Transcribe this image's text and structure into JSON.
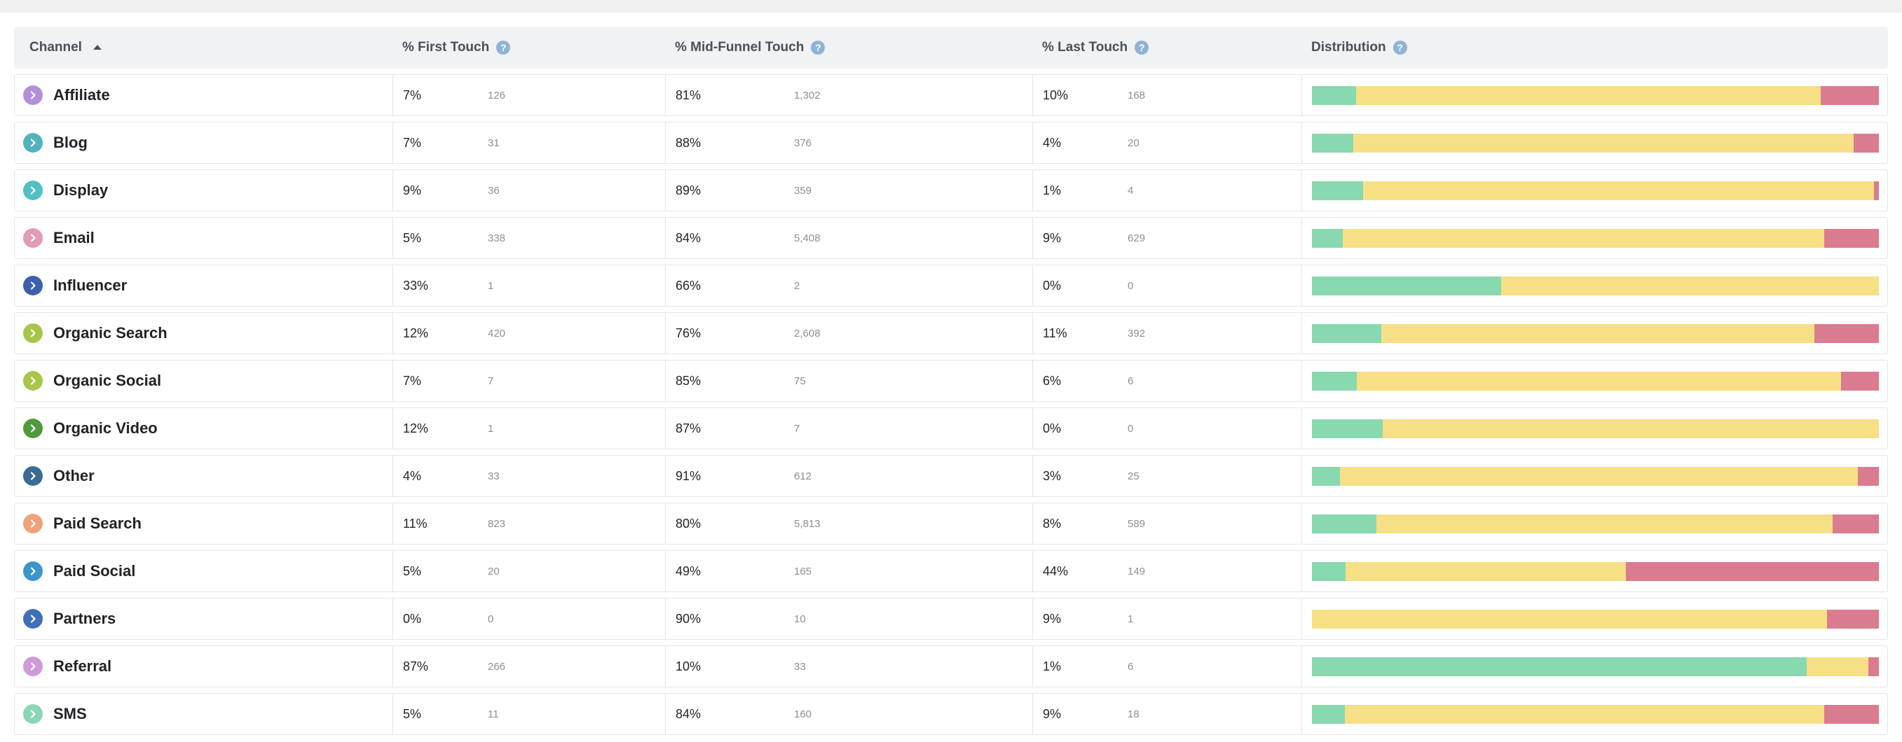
{
  "header": {
    "channel": "Channel",
    "first_touch": "% First Touch",
    "mid_funnel": "% Mid-Funnel Touch",
    "last_touch": "% Last Touch",
    "distribution": "Distribution",
    "help_glyph": "?"
  },
  "colors": {
    "first": "#88d8b0",
    "mid": "#f7df86",
    "last": "#db7b8f"
  },
  "rows": [
    {
      "channel": "Affiliate",
      "icon_color": "#b48fd9",
      "first_pct": "7%",
      "first_count": "126",
      "mid_pct": "81%",
      "mid_count": "1,302",
      "last_pct": "10%",
      "last_count": "168",
      "dist": [
        7.8,
        82.0,
        10.2
      ]
    },
    {
      "channel": "Blog",
      "icon_color": "#4fb3bf",
      "first_pct": "7%",
      "first_count": "31",
      "mid_pct": "88%",
      "mid_count": "376",
      "last_pct": "4%",
      "last_count": "20",
      "dist": [
        7.3,
        88.3,
        4.4
      ]
    },
    {
      "channel": "Display",
      "icon_color": "#4fc0c4",
      "first_pct": "9%",
      "first_count": "36",
      "mid_pct": "89%",
      "mid_count": "359",
      "last_pct": "1%",
      "last_count": "4",
      "dist": [
        9.0,
        90.1,
        0.9
      ]
    },
    {
      "channel": "Email",
      "icon_color": "#e39ab6",
      "first_pct": "5%",
      "first_count": "338",
      "mid_pct": "84%",
      "mid_count": "5,408",
      "last_pct": "9%",
      "last_count": "629",
      "dist": [
        5.4,
        84.9,
        9.7
      ]
    },
    {
      "channel": "Influencer",
      "icon_color": "#3d5fb0",
      "first_pct": "33%",
      "first_count": "1",
      "mid_pct": "66%",
      "mid_count": "2",
      "last_pct": "0%",
      "last_count": "0",
      "dist": [
        33.4,
        66.6,
        0
      ]
    },
    {
      "channel": "Organic Search",
      "icon_color": "#a6c64a",
      "first_pct": "12%",
      "first_count": "420",
      "mid_pct": "76%",
      "mid_count": "2,608",
      "last_pct": "11%",
      "last_count": "392",
      "dist": [
        12.2,
        76.4,
        11.4
      ]
    },
    {
      "channel": "Organic Social",
      "icon_color": "#a9c54a",
      "first_pct": "7%",
      "first_count": "7",
      "mid_pct": "85%",
      "mid_count": "75",
      "last_pct": "6%",
      "last_count": "6",
      "dist": [
        7.9,
        85.4,
        6.7
      ]
    },
    {
      "channel": "Organic Video",
      "icon_color": "#4f9b3b",
      "first_pct": "12%",
      "first_count": "1",
      "mid_pct": "87%",
      "mid_count": "7",
      "last_pct": "0%",
      "last_count": "0",
      "dist": [
        12.5,
        87.5,
        0
      ]
    },
    {
      "channel": "Other",
      "icon_color": "#3b6a96",
      "first_pct": "4%",
      "first_count": "33",
      "mid_pct": "91%",
      "mid_count": "612",
      "last_pct": "3%",
      "last_count": "25",
      "dist": [
        4.9,
        91.4,
        3.7
      ]
    },
    {
      "channel": "Paid Search",
      "icon_color": "#f0a27a",
      "first_pct": "11%",
      "first_count": "823",
      "mid_pct": "80%",
      "mid_count": "5,813",
      "last_pct": "8%",
      "last_count": "589",
      "dist": [
        11.4,
        80.4,
        8.2
      ]
    },
    {
      "channel": "Paid Social",
      "icon_color": "#3b95c9",
      "first_pct": "5%",
      "first_count": "20",
      "mid_pct": "49%",
      "mid_count": "165",
      "last_pct": "44%",
      "last_count": "149",
      "dist": [
        5.9,
        49.5,
        44.6
      ]
    },
    {
      "channel": "Partners",
      "icon_color": "#3f6fb9",
      "first_pct": "0%",
      "first_count": "0",
      "mid_pct": "90%",
      "mid_count": "10",
      "last_pct": "9%",
      "last_count": "1",
      "dist": [
        0,
        90.9,
        9.1
      ]
    },
    {
      "channel": "Referral",
      "icon_color": "#cf9ad8",
      "first_pct": "87%",
      "first_count": "266",
      "mid_pct": "10%",
      "mid_count": "33",
      "last_pct": "1%",
      "last_count": "6",
      "dist": [
        87.3,
        10.8,
        1.9
      ]
    },
    {
      "channel": "SMS",
      "icon_color": "#8ad6b6",
      "first_pct": "5%",
      "first_count": "11",
      "mid_pct": "84%",
      "mid_count": "160",
      "last_pct": "9%",
      "last_count": "18",
      "dist": [
        5.8,
        84.6,
        9.6
      ]
    }
  ]
}
